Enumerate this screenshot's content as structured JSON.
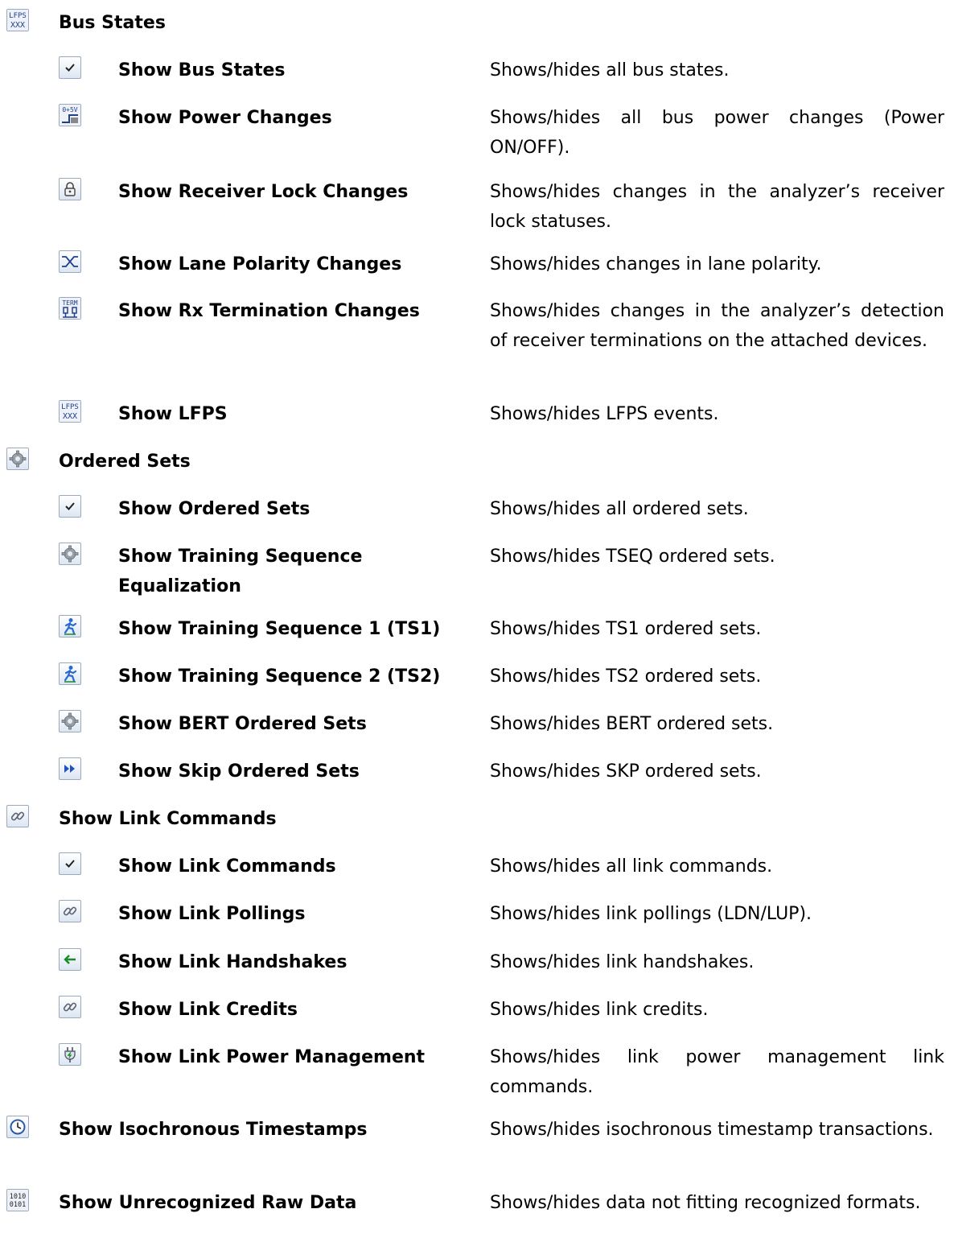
{
  "sections": [
    {
      "icon": "lfps-icon",
      "label": "Bus States",
      "items": [
        {
          "icon": "checkmark-icon",
          "label": "Show Bus States",
          "desc": "Shows/hides all bus states."
        },
        {
          "icon": "power-change-icon",
          "label": "Show Power Changes",
          "desc": "Shows/hides all bus power changes (Power ON/OFF)."
        },
        {
          "icon": "lock-icon",
          "label": "Show Receiver Lock Changes",
          "desc": "Shows/hides changes in the analyzer’s receiver lock statuses."
        },
        {
          "icon": "polarity-icon",
          "label": "Show Lane Polarity Changes",
          "desc": "Shows/hides changes in lane polarity."
        },
        {
          "icon": "termination-icon",
          "label": "Show Rx Termination Changes",
          "desc": "Shows/hides changes in the analyzer’s detection of receiver terminations on the attached devices."
        },
        {
          "icon": "lfps-icon",
          "label": "Show LFPS",
          "desc": "Shows/hides LFPS events."
        }
      ]
    },
    {
      "icon": "gear-icon",
      "label": "Ordered Sets",
      "items": [
        {
          "icon": "checkmark-icon",
          "label": "Show Ordered Sets",
          "desc": "Shows/hides all ordered sets."
        },
        {
          "icon": "gear-icon",
          "label": "Show Training Sequence Equalization",
          "desc": "Shows/hides TSEQ ordered sets."
        },
        {
          "icon": "runner-icon",
          "label": "Show Training Sequence 1 (TS1)",
          "desc": "Shows/hides TS1 ordered sets."
        },
        {
          "icon": "runner-icon",
          "label": "Show Training Sequence 2 (TS2)",
          "desc": "Shows/hides TS2 ordered sets."
        },
        {
          "icon": "gear-icon",
          "label": "Show BERT Ordered Sets",
          "desc": "Shows/hides BERT ordered sets."
        },
        {
          "icon": "skip-icon",
          "label": "Show Skip Ordered Sets",
          "desc": "Shows/hides SKP ordered sets."
        }
      ]
    },
    {
      "icon": "chain-link-icon",
      "label": "Show Link Commands",
      "items": [
        {
          "icon": "checkmark-icon",
          "label": "Show Link Commands",
          "desc": "Shows/hides all link commands."
        },
        {
          "icon": "chain-link-icon",
          "label": "Show Link Pollings",
          "desc": "Shows/hides link pollings (LDN/LUP)."
        },
        {
          "icon": "arrow-left-icon",
          "label": "Show Link Handshakes",
          "desc": "Shows/hides link handshakes."
        },
        {
          "icon": "chain-link-icon",
          "label": "Show Link Credits",
          "desc": "Shows/hides link credits."
        },
        {
          "icon": "power-plug-icon",
          "label": "Show Link Power Management",
          "desc": "Shows/hides link power management link commands."
        }
      ]
    }
  ],
  "top_items": [
    {
      "icon": "clock-icon",
      "label": "Show Isochronous Timestamps",
      "desc": "Shows/hides isochronous timestamp transactions."
    },
    {
      "icon": "binary-data-icon",
      "label": "Show Unrecognized Raw Data",
      "desc": "Shows/hides data not fitting recognized formats."
    }
  ],
  "icon_glyphs": {
    "lfps-icon": [
      "LFPS",
      "XXX"
    ],
    "termination-icon": [
      "TERM",
      "ǫǫ"
    ],
    "power-change-icon": [
      "0+5V"
    ],
    "binary-data-icon": [
      "1010",
      "0101"
    ]
  },
  "colors": {
    "icon_blue": "#1f3f8f",
    "handshake_green": "#1a8a2a",
    "skip_blue": "#2050c0"
  }
}
